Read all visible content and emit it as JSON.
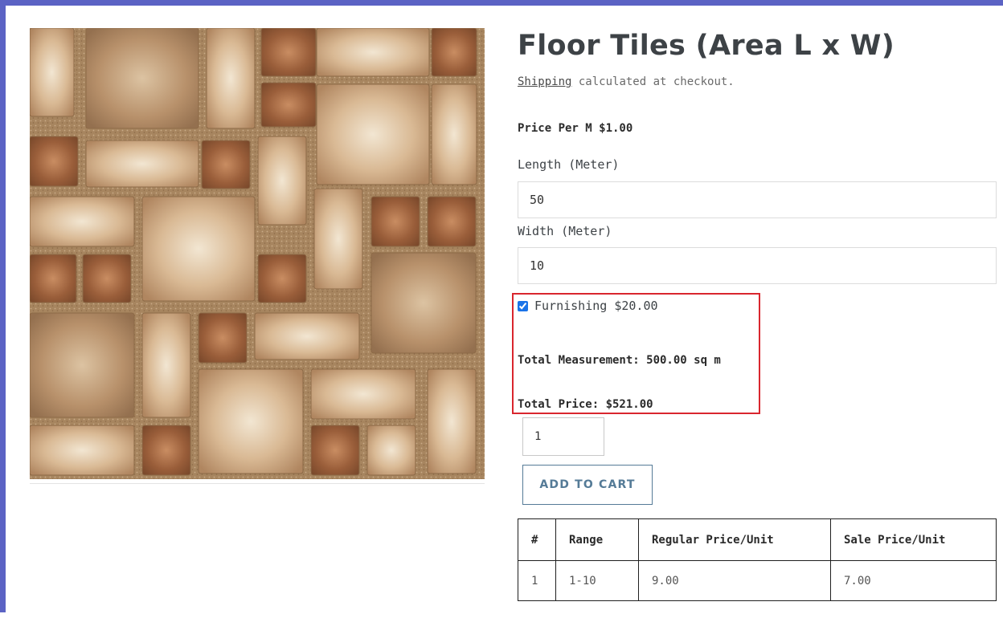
{
  "product": {
    "title": "Floor Tiles (Area L x W)",
    "shipping_link": "Shipping",
    "shipping_rest": " calculated at checkout."
  },
  "pricing": {
    "price_per_label": "Price Per M $1.00"
  },
  "fields": {
    "length_label": "Length (Meter)",
    "length_value": "50",
    "width_label": "Width (Meter)",
    "width_value": "10"
  },
  "furnishing": {
    "label": "Furnishing $20.00",
    "checked": true
  },
  "totals": {
    "measurement": "Total Measurement: 500.00 sq m",
    "price": "Total Price: $521.00"
  },
  "cart": {
    "quantity": "1",
    "add_label": "ADD TO CART"
  },
  "price_table": {
    "headers": [
      "#",
      "Range",
      "Regular Price/Unit",
      "Sale Price/Unit"
    ],
    "rows": [
      [
        "1",
        "1-10",
        "9.00",
        "7.00"
      ]
    ]
  },
  "colors": {
    "frame_border": "#5b63c4",
    "highlight_border": "#d9262e",
    "button_accent": "#557b97"
  }
}
